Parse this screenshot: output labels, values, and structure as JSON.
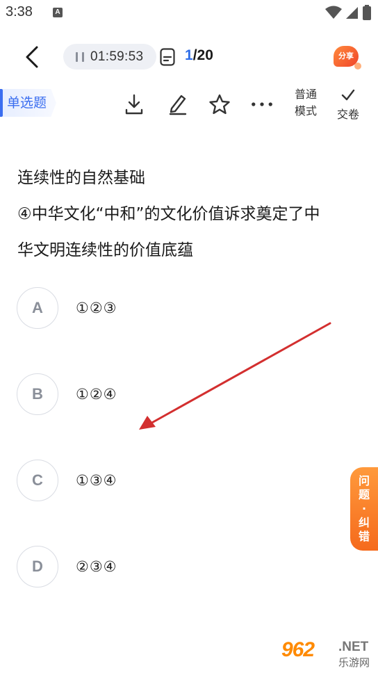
{
  "status_bar": {
    "time": "3:38",
    "notification_glyph": "A",
    "icons": [
      "wifi-icon",
      "signal-icon",
      "battery-icon"
    ]
  },
  "header": {
    "timer": "01:59:53",
    "progress_current": "1",
    "progress_total": "/20",
    "share_badge": "分享"
  },
  "toolbar": {
    "question_type": "单选题",
    "mode_line1": "普通",
    "mode_line2": "模式",
    "submit_label": "交卷",
    "icons": [
      "download-icon",
      "edit-icon",
      "star-icon",
      "more-icon",
      "check-icon"
    ]
  },
  "question": {
    "lines": [
      "连续性的自然基础",
      "④中华文化“中和”的文化价值诉求奠定了中",
      "华文明连续性的价值底蕴"
    ]
  },
  "options": [
    {
      "letter": "A",
      "text": "①②③"
    },
    {
      "letter": "B",
      "text": "①②④"
    },
    {
      "letter": "C",
      "text": "①③④"
    },
    {
      "letter": "D",
      "text": "②③④"
    }
  ],
  "feedback_tab": {
    "label": "问题·纠错"
  },
  "watermark": {
    "main": "962",
    "net": ".NET",
    "sub": "乐游网"
  },
  "colors": {
    "accent_blue": "#2f6ee8",
    "feedback_orange": "#f56a1c",
    "annotation_red": "#d32f2f"
  }
}
